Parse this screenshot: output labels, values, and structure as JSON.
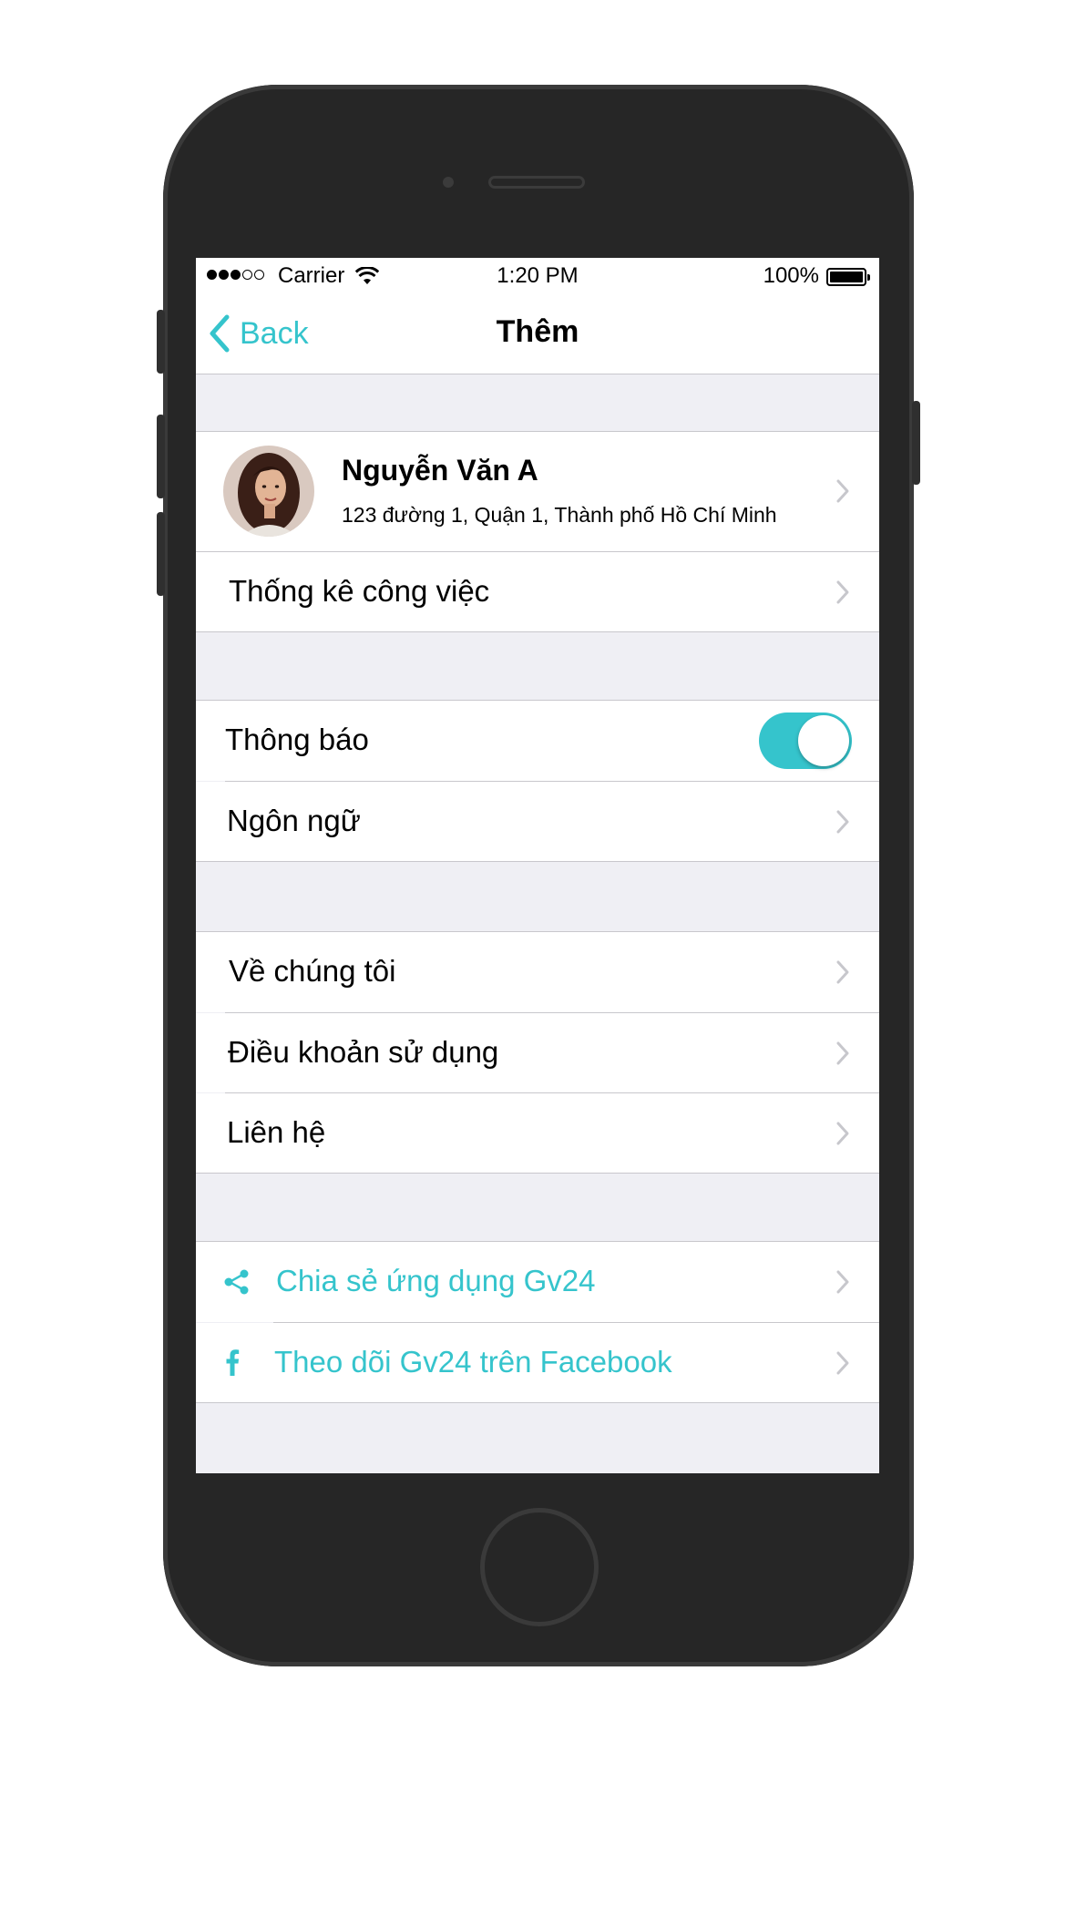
{
  "status_bar": {
    "carrier": "Carrier",
    "time": "1:20 PM",
    "battery": "100%",
    "signal_bars": 3,
    "signal_total": 5
  },
  "nav": {
    "back_label": "Back",
    "title": "Thêm"
  },
  "profile": {
    "name": "Nguyễn Văn A",
    "address": "123 đường 1, Quận 1, Thành phố Hồ Chí Minh"
  },
  "rows": {
    "stats": "Thống kê công việc",
    "notifications": "Thông báo",
    "notifications_on": true,
    "language": "Ngôn ngữ",
    "about": "Về chúng tôi",
    "terms": "Điều khoản sử dụng",
    "contact": "Liên hệ",
    "share": "Chia sẻ ứng dụng Gv24",
    "follow": "Theo dõi Gv24 trên Facebook"
  },
  "colors": {
    "accent": "#35c4cc",
    "group_background": "#efeff4",
    "separator": "#c8c7cc",
    "phone_body": "#262626"
  },
  "icons": {
    "back": "chevron-left-icon",
    "disclosure": "chevron-right-icon",
    "share": "share-icon",
    "facebook": "facebook-icon"
  }
}
